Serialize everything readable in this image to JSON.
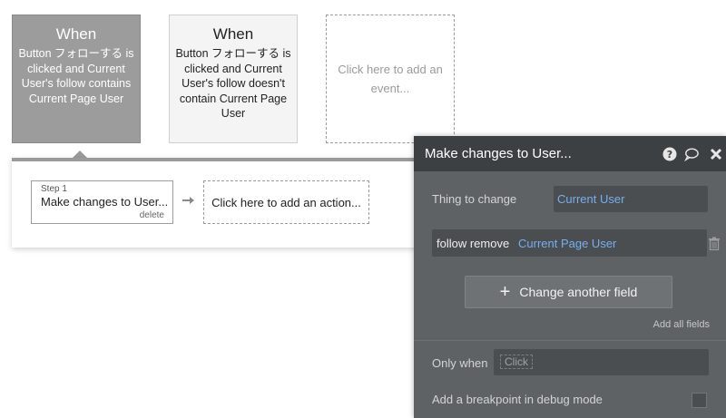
{
  "events": [
    {
      "when": "When",
      "description": "Button フォローする is clicked and Current User's follow contains Current Page User"
    },
    {
      "when": "When",
      "description": "Button フォローする is clicked and Current User's follow doesn't contain Current Page User"
    }
  ],
  "add_event": "Click here to add an event...",
  "workflow": {
    "step_label": "Step 1",
    "step_title": "Make changes to User...",
    "delete_label": "delete",
    "add_action": "Click here to add an action..."
  },
  "panel": {
    "title": "Make changes to User...",
    "thing_to_change_label": "Thing to change",
    "thing_to_change_value": "Current User",
    "field_name": "follow remove",
    "field_value": "Current Page User",
    "change_button": "Change another field",
    "add_all": "Add all fields",
    "only_when_label": "Only when",
    "only_when_value": "Click",
    "breakpoint_label": "Add a breakpoint in debug mode"
  },
  "icons": [
    "help-icon",
    "comment-icon",
    "close-icon",
    "trash-icon",
    "arrow-right-icon",
    "plus-icon"
  ]
}
